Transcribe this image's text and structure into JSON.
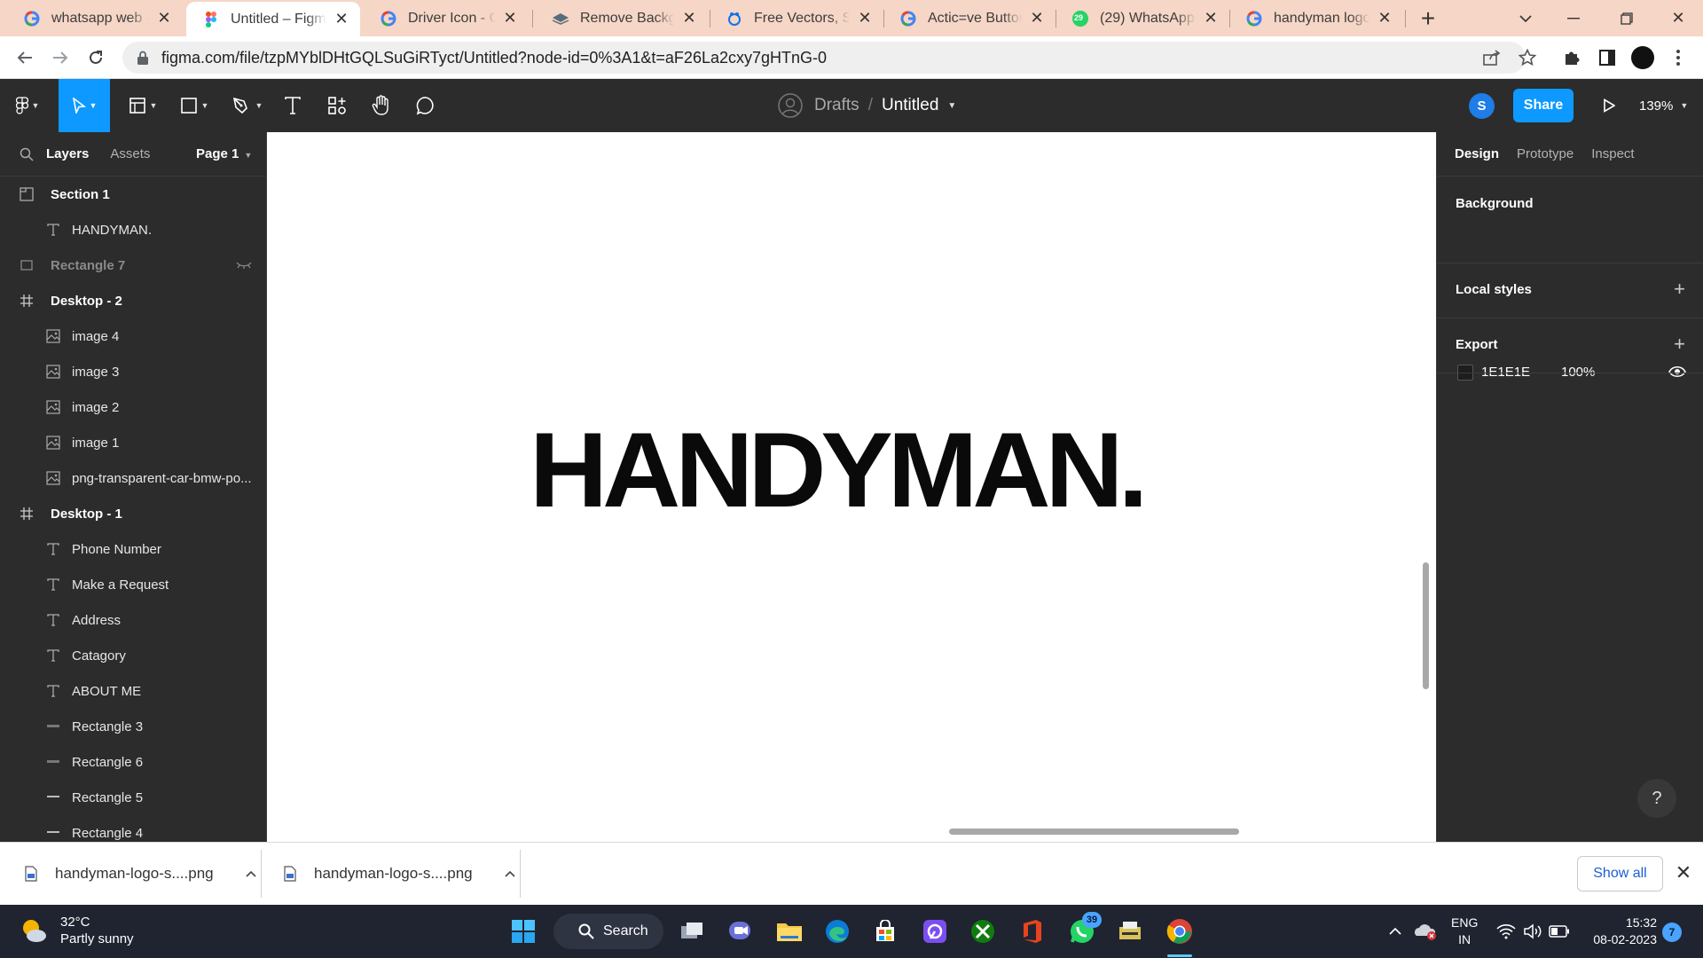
{
  "browser": {
    "tabs": [
      {
        "title": "whatsapp web - G",
        "favicon": "google-icon"
      },
      {
        "title": "Untitled – Figma",
        "favicon": "figma-icon",
        "active": true
      },
      {
        "title": "Driver Icon - Goo",
        "favicon": "google-icon"
      },
      {
        "title": "Remove Backgrou",
        "favicon": "removebg-icon"
      },
      {
        "title": "Free Vectors, Stoc",
        "favicon": "freepik-icon"
      },
      {
        "title": "Actic=ve Button T",
        "favicon": "google-icon"
      },
      {
        "title": "(29) WhatsApp",
        "favicon": "whatsapp-icon",
        "badge": "29"
      },
      {
        "title": "handyman logo -",
        "favicon": "google-icon"
      }
    ],
    "url": "figma.com/file/tzpMYblDHtGQLSuGiRTyct/Untitled?node-id=0%3A1&t=aF26La2cxy7gHTnG-0"
  },
  "figma": {
    "breadcrumb_drafts": "Drafts",
    "breadcrumb_sep": "/",
    "file_name": "Untitled",
    "avatar_initial": "S",
    "share_label": "Share",
    "zoom_level": "139%",
    "accent_color": "#0d99ff"
  },
  "layers_panel": {
    "tab_layers": "Layers",
    "tab_assets": "Assets",
    "page_label": "Page 1",
    "items": [
      {
        "name": "Section 1",
        "type": "section",
        "level": 0
      },
      {
        "name": "HANDYMAN.",
        "type": "text",
        "level": 1
      },
      {
        "name": "Rectangle 7",
        "type": "rectangle",
        "level": 0,
        "hidden": true
      },
      {
        "name": "Desktop - 2",
        "type": "frame",
        "level": 0
      },
      {
        "name": "image 4",
        "type": "image",
        "level": 1
      },
      {
        "name": "image 3",
        "type": "image",
        "level": 1
      },
      {
        "name": "image 2",
        "type": "image",
        "level": 1
      },
      {
        "name": "image 1",
        "type": "image",
        "level": 1
      },
      {
        "name": "png-transparent-car-bmw-po...",
        "type": "image",
        "level": 1
      },
      {
        "name": "Desktop - 1",
        "type": "frame",
        "level": 0
      },
      {
        "name": "Phone Number",
        "type": "text",
        "level": 1
      },
      {
        "name": "Make a Request",
        "type": "text",
        "level": 1
      },
      {
        "name": "Address",
        "type": "text",
        "level": 1
      },
      {
        "name": "Catagory",
        "type": "text",
        "level": 1
      },
      {
        "name": "ABOUT ME",
        "type": "text",
        "level": 1
      },
      {
        "name": "Rectangle 3",
        "type": "line",
        "level": 1
      },
      {
        "name": "Rectangle 6",
        "type": "line",
        "level": 1
      },
      {
        "name": "Rectangle 5",
        "type": "line",
        "level": 1
      },
      {
        "name": "Rectangle 4",
        "type": "line",
        "level": 1
      }
    ]
  },
  "canvas": {
    "logo_text": "HANDYMAN."
  },
  "properties_panel": {
    "tab_design": "Design",
    "tab_prototype": "Prototype",
    "tab_inspect": "Inspect",
    "background_heading": "Background",
    "background_hex": "1E1E1E",
    "background_opacity": "100%",
    "local_styles_heading": "Local styles",
    "export_heading": "Export",
    "help_label": "?"
  },
  "downloads": {
    "items": [
      {
        "name": "handyman-logo-s....png"
      },
      {
        "name": "handyman-logo-s....png"
      }
    ],
    "show_all_label": "Show all"
  },
  "taskbar": {
    "weather_temp": "32°C",
    "weather_desc": "Partly sunny",
    "search_label": "Search",
    "whatsapp_badge": "39",
    "lang_line1": "ENG",
    "lang_line2": "IN",
    "time": "15:32",
    "date": "08-02-2023",
    "notification_count": "7"
  }
}
